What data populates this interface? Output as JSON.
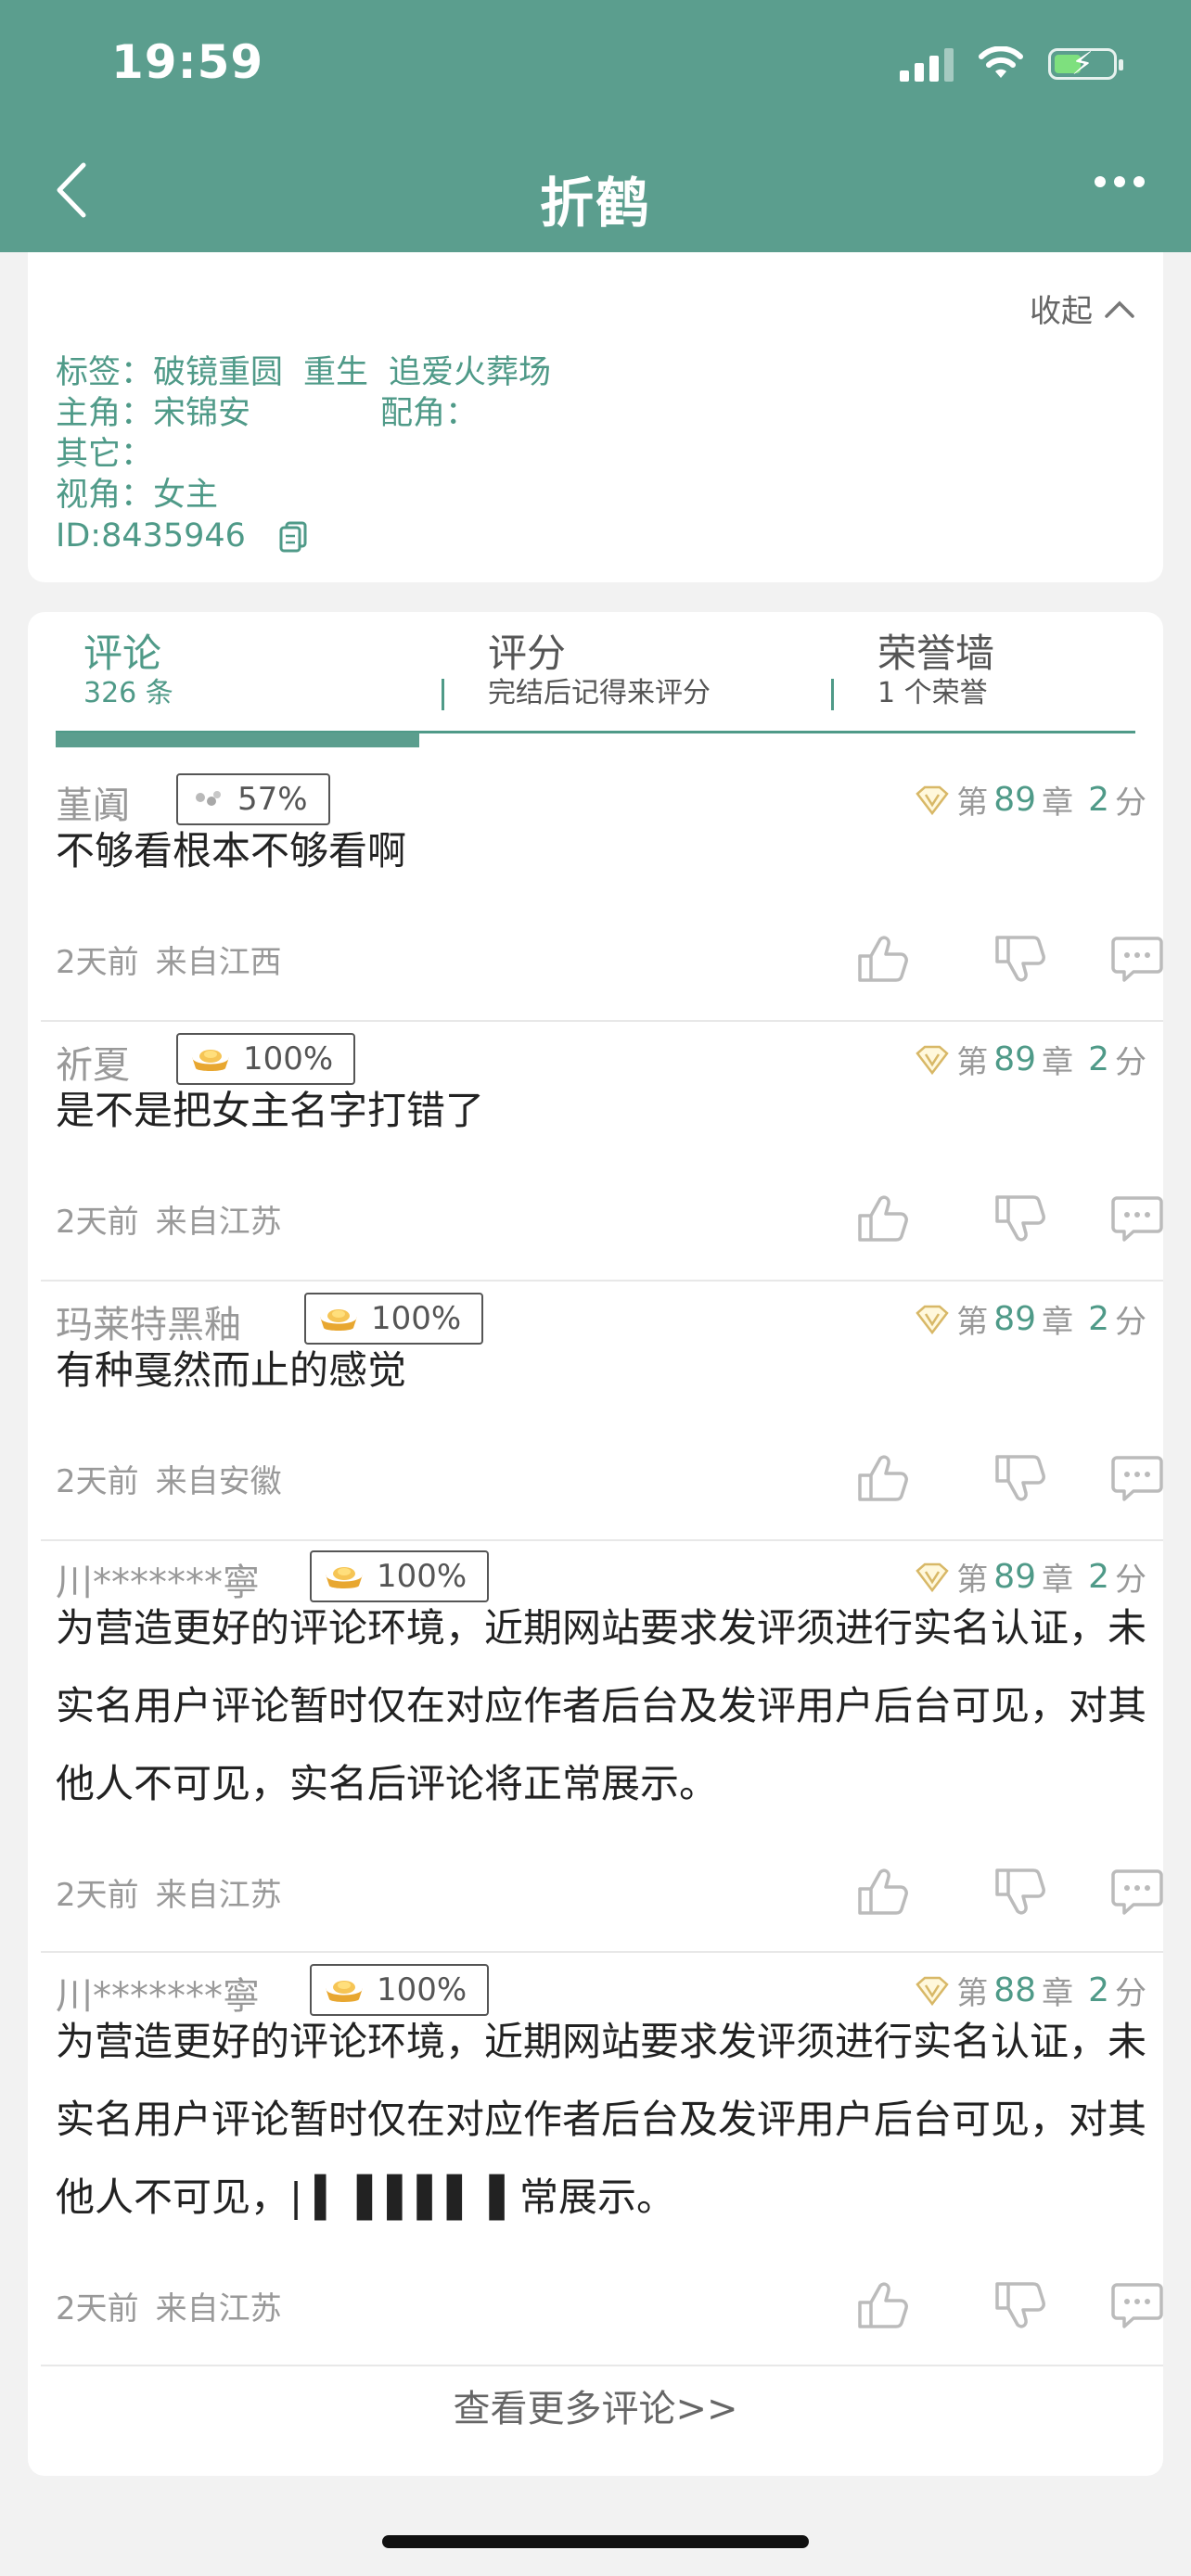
{
  "status_bar": {
    "time": "19:59"
  },
  "nav": {
    "title": "折鹤"
  },
  "info": {
    "collapse_label": "收起",
    "tags_label": "标签：",
    "tags": [
      "破镜重圆",
      "重生",
      "追爱火葬场"
    ],
    "protagonist_label": "主角：",
    "protagonist": "宋锦安",
    "supporting_label": "配角：",
    "other_label": "其它：",
    "pov_label": "视角：",
    "pov": "女主",
    "id": "ID:8435946"
  },
  "tabs": [
    {
      "label": "评论",
      "sub": "326 条"
    },
    {
      "label": "评分",
      "sub": "完结后记得来评分"
    },
    {
      "label": "荣誉墙",
      "sub": "1 个荣誉"
    }
  ],
  "comments": [
    {
      "user": "堇阗",
      "badge": "57%",
      "badge_icon": "silver-ingot-icon",
      "ch_prefix": "第",
      "chapter": "89",
      "ch_suffix": "章",
      "score": "2",
      "score_unit": "分",
      "text": "不够看根本不够看啊",
      "time": "2天前",
      "location": "来自江西"
    },
    {
      "user": "祈夏",
      "badge": "100%",
      "badge_icon": "gold-ingot-icon",
      "ch_prefix": "第",
      "chapter": "89",
      "ch_suffix": "章",
      "score": "2",
      "score_unit": "分",
      "text": "是不是把女主名字打错了",
      "time": "2天前",
      "location": "来自江苏"
    },
    {
      "user": "玛莱特黑釉",
      "badge": "100%",
      "badge_icon": "gold-ingot-icon",
      "ch_prefix": "第",
      "chapter": "89",
      "ch_suffix": "章",
      "score": "2",
      "score_unit": "分",
      "text": "有种戛然而止的感觉",
      "time": "2天前",
      "location": "来自安徽"
    },
    {
      "user": "川*******寧",
      "badge": "100%",
      "badge_icon": "gold-ingot-icon",
      "ch_prefix": "第",
      "chapter": "89",
      "ch_suffix": "章",
      "score": "2",
      "score_unit": "分",
      "text": "为营造更好的评论环境，近期网站要求发评须进行实名认证，未实名用户评论暂时仅在对应作者后台及发评用户后台可见，对其他人不可见，实名后评论将正常展示。",
      "time": "2天前",
      "location": "来自江苏"
    },
    {
      "user": "川*******寧",
      "badge": "100%",
      "badge_icon": "gold-ingot-icon",
      "ch_prefix": "第",
      "chapter": "88",
      "ch_suffix": "章",
      "score": "2",
      "score_unit": "分",
      "text": "为营造更好的评论环境，近期网站要求发评须进行实名认证，未实名用户评论暂时仅在对应作者后台及发评用户后台可见，对其他人不可见，| ▍ ▌▌▌▌ ▌常展示。",
      "time": "2天前",
      "location": "来自江苏"
    }
  ],
  "more_comments": "查看更多评论>>",
  "colors": {
    "theme": "#5b9e8e",
    "accent_text": "#4f9a88"
  }
}
